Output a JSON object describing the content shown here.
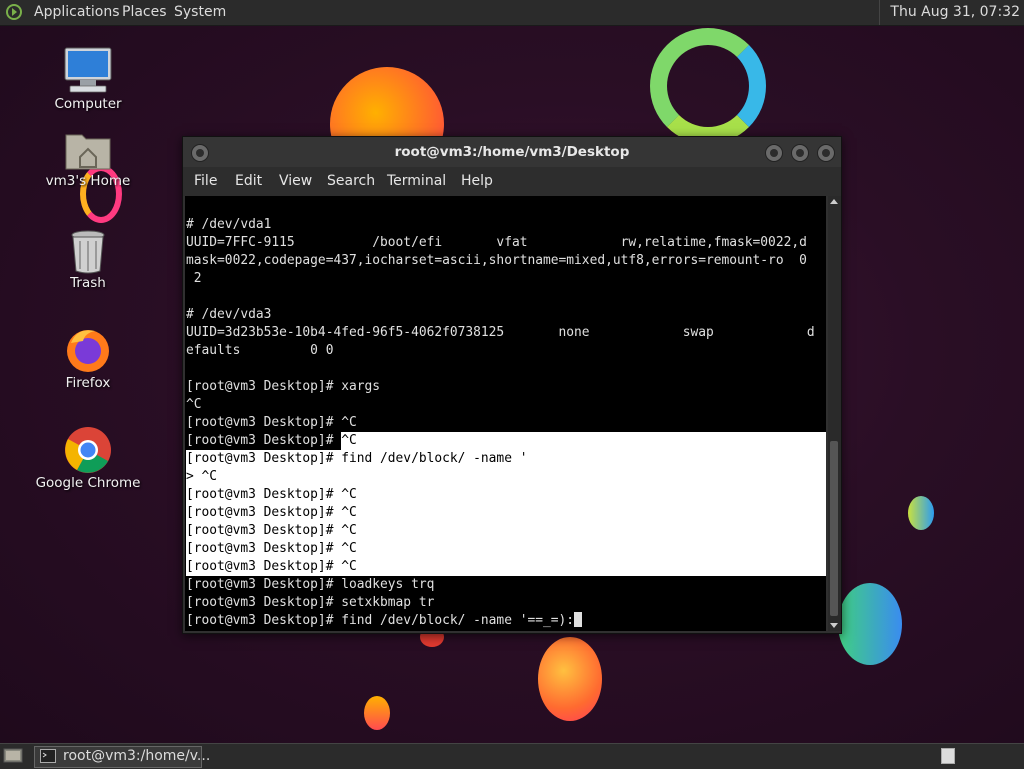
{
  "top_panel": {
    "menus": [
      "Applications",
      "Places",
      "System"
    ],
    "clock": "Thu Aug 31, 07:32"
  },
  "desktop_icons": [
    {
      "label": "Computer",
      "icon": "computer-icon"
    },
    {
      "label": "vm3's Home",
      "icon": "home-folder-icon"
    },
    {
      "label": "Trash",
      "icon": "trash-icon"
    },
    {
      "label": "Firefox",
      "icon": "firefox-icon"
    },
    {
      "label": "Google Chrome",
      "icon": "chrome-icon"
    }
  ],
  "terminal": {
    "title": "root@vm3:/home/vm3/Desktop",
    "menu": [
      "File",
      "Edit",
      "View",
      "Search",
      "Terminal",
      "Help"
    ],
    "lines": [
      "# /dev/vda1",
      "UUID=7FFC-9115          /boot/efi       vfat            rw,relatime,fmask=0022,d",
      "mask=0022,codepage=437,iocharset=ascii,shortname=mixed,utf8,errors=remount-ro  0",
      " 2",
      "",
      "# /dev/vda3",
      "UUID=3d23b53e-10b4-4fed-96f5-4062f0738125       none            swap            d",
      "efaults         0 0",
      "",
      "[root@vm3 Desktop]# xargs",
      "^C",
      "[root@vm3 Desktop]# ^C",
      "[root@vm3 Desktop]# ^C",
      "[root@vm3 Desktop]# find /dev/block/ -name '",
      "> ^C",
      "[root@vm3 Desktop]# ^C",
      "[root@vm3 Desktop]# ^C",
      "[root@vm3 Desktop]# ^C",
      "[root@vm3 Desktop]# ^C",
      "[root@vm3 Desktop]# ^C",
      "[root@vm3 Desktop]# loadkeys trq",
      "[root@vm3 Desktop]# setxkbmap tr",
      "[root@vm3 Desktop]# find /dev/block/ -name '==_=):"
    ]
  },
  "taskbar": {
    "window_label": "root@vm3:/home/v..."
  }
}
